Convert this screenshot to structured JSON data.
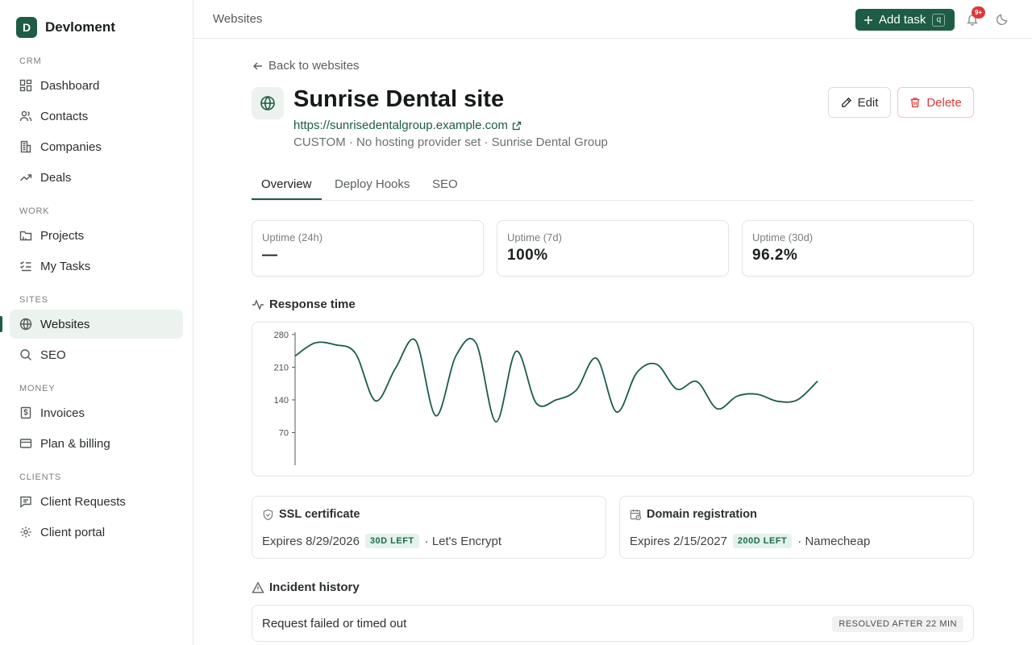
{
  "app": {
    "logo_letter": "D",
    "name": "Devloment"
  },
  "sidebar": {
    "sections": [
      {
        "title": "CRM",
        "items": [
          {
            "label": "Dashboard",
            "icon": "dashboard-icon"
          },
          {
            "label": "Contacts",
            "icon": "users-icon"
          },
          {
            "label": "Companies",
            "icon": "building-icon"
          },
          {
            "label": "Deals",
            "icon": "trending-up-icon"
          }
        ]
      },
      {
        "title": "WORK",
        "items": [
          {
            "label": "Projects",
            "icon": "folder-icon"
          },
          {
            "label": "My Tasks",
            "icon": "checklist-icon"
          }
        ]
      },
      {
        "title": "SITES",
        "items": [
          {
            "label": "Websites",
            "icon": "globe-icon",
            "active": true
          },
          {
            "label": "SEO",
            "icon": "search-icon"
          }
        ]
      },
      {
        "title": "MONEY",
        "items": [
          {
            "label": "Invoices",
            "icon": "dollar-receipt-icon"
          },
          {
            "label": "Plan & billing",
            "icon": "credit-card-icon"
          }
        ]
      },
      {
        "title": "CLIENTS",
        "items": [
          {
            "label": "Client Requests",
            "icon": "message-icon"
          },
          {
            "label": "Client portal",
            "icon": "gear-icon"
          }
        ]
      }
    ]
  },
  "topbar": {
    "title": "Websites",
    "add_task_label": "Add task",
    "add_task_shortcut": "q",
    "notification_badge": "9+"
  },
  "site": {
    "back_label": "Back to websites",
    "title": "Sunrise Dental site",
    "url": "https://sunrisedentalgroup.example.com",
    "meta": "CUSTOM · No hosting provider set · Sunrise Dental Group",
    "edit_label": "Edit",
    "delete_label": "Delete"
  },
  "tabs": [
    {
      "label": "Overview",
      "active": true
    },
    {
      "label": "Deploy Hooks"
    },
    {
      "label": "SEO"
    }
  ],
  "stats": [
    {
      "label": "Uptime (24h)",
      "value": "—"
    },
    {
      "label": "Uptime (7d)",
      "value": "100%"
    },
    {
      "label": "Uptime (30d)",
      "value": "96.2%"
    }
  ],
  "response_time": {
    "title": "Response time"
  },
  "chart_data": {
    "type": "line",
    "title": "Response time",
    "yticks": [
      70,
      140,
      210,
      280
    ],
    "ylim": [
      0,
      285
    ],
    "grid": false,
    "color": "#1d5c45",
    "series": [
      {
        "values": [
          234,
          262,
          258,
          240,
          138,
          208,
          267,
          106,
          234,
          262,
          93,
          244,
          133,
          140,
          161,
          229,
          114,
          198,
          216,
          163,
          179,
          121,
          148,
          152,
          137,
          140,
          180
        ]
      }
    ]
  },
  "ssl": {
    "title": "SSL certificate",
    "expires": "Expires 8/29/2026",
    "badge": "30D LEFT",
    "provider": "· Let's Encrypt"
  },
  "domain": {
    "title": "Domain registration",
    "expires": "Expires 2/15/2027",
    "badge": "200D LEFT",
    "provider": "· Namecheap"
  },
  "incidents": {
    "title": "Incident history",
    "rows": [
      {
        "text": "Request failed or timed out",
        "badge": "RESOLVED AFTER 22 MIN"
      }
    ]
  }
}
